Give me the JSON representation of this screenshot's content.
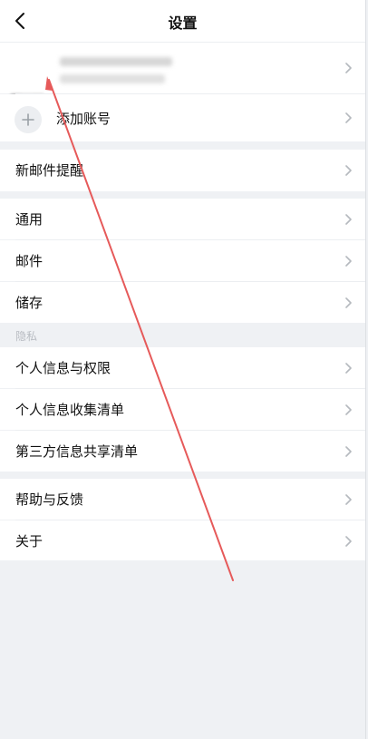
{
  "header": {
    "title": "设置"
  },
  "account": {
    "add_label": "添加账号"
  },
  "groups": {
    "g1": [
      "新邮件提醒"
    ],
    "g2": [
      "通用",
      "邮件",
      "储存"
    ],
    "privacy_caption": "隐私",
    "g3": [
      "个人信息与权限",
      "个人信息收集清单",
      "第三方信息共享清单"
    ],
    "g4": [
      "帮助与反馈",
      "关于"
    ]
  },
  "colors": {
    "annotation_arrow": "#e65a5a",
    "page_bg": "#eff1f4"
  },
  "icons": [
    "back-icon",
    "plus-icon",
    "chevron-right-icon"
  ]
}
